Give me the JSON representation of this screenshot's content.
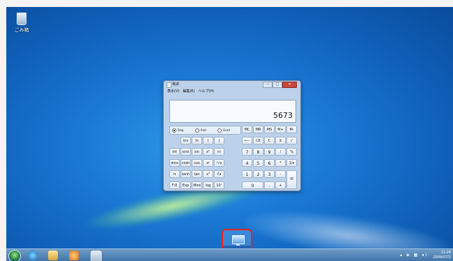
{
  "desktop": {
    "recycle_bin_label": "ごみ箱"
  },
  "window": {
    "title": "電卓",
    "controls": {
      "minimize": "—",
      "maximize": "□",
      "close": "✕"
    },
    "menu": [
      "表示(V)",
      "編集(E)",
      "ヘルプ(H)"
    ],
    "display_value": "5673",
    "angle_modes": {
      "deg": "Deg",
      "rad": "Rad",
      "grad": "Grad",
      "selected": "Deg"
    },
    "buttons": {
      "mc": "MC",
      "mr": "MR",
      "ms": "MS",
      "mplus": "M+",
      "mminus": "M-",
      "inv": "Inv",
      "ln": "ln",
      "lparen": "(",
      "rparen": ")",
      "back": "⟵",
      "ce": "CE",
      "c": "C",
      "pm": "±",
      "sqrt": "√",
      "int": "Int",
      "sinh": "sinh",
      "sin": "sin",
      "x2": "x²",
      "fact": "n!",
      "n7": "7",
      "n8": "8",
      "n9": "9",
      "div": "/",
      "pct": "%",
      "dms": "dms",
      "cosh": "cosh",
      "cos": "cos",
      "xy": "xʸ",
      "yroot": "ʸ√x",
      "n4": "4",
      "n5": "5",
      "n6": "6",
      "mul": "*",
      "inv1x": "1/x",
      "pi": "π",
      "tanh": "tanh",
      "tan": "tan",
      "x3": "x³",
      "croot": "∛x",
      "n1": "1",
      "n2": "2",
      "n3": "3",
      "sub": "-",
      "eq": "=",
      "fe": "F-E",
      "exp": "Exp",
      "mod": "Mod",
      "log": "log",
      "tenx": "10ˣ",
      "n0": "0",
      "dot": ".",
      "add": "+"
    }
  },
  "taskbar": {
    "clock_time": "11:24",
    "clock_date": "2009/07/2"
  }
}
